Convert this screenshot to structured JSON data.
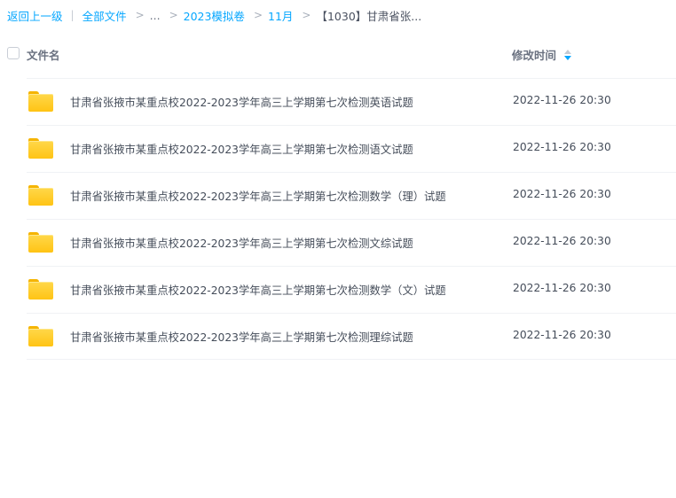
{
  "breadcrumb": {
    "back_label": "返回上一级",
    "divider": "|",
    "items": [
      {
        "label": "全部文件"
      },
      {
        "label": "..."
      },
      {
        "label": "2023模拟卷"
      },
      {
        "label": "11月"
      },
      {
        "label": "【1030】甘肃省张..."
      }
    ]
  },
  "table": {
    "columns": {
      "name": "文件名",
      "modified": "修改时间"
    },
    "rows": [
      {
        "name": "甘肃省张掖市某重点校2022-2023学年高三上学期第七次检测英语试题",
        "time": "2022-11-26 20:30"
      },
      {
        "name": "甘肃省张掖市某重点校2022-2023学年高三上学期第七次检测语文试题",
        "time": "2022-11-26 20:30"
      },
      {
        "name": "甘肃省张掖市某重点校2022-2023学年高三上学期第七次检测数学（理）试题",
        "time": "2022-11-26 20:30"
      },
      {
        "name": "甘肃省张掖市某重点校2022-2023学年高三上学期第七次检测文综试题",
        "time": "2022-11-26 20:30"
      },
      {
        "name": "甘肃省张掖市某重点校2022-2023学年高三上学期第七次检测数学（文）试题",
        "time": "2022-11-26 20:30"
      },
      {
        "name": "甘肃省张掖市某重点校2022-2023学年高三上学期第七次检测理综试题",
        "time": "2022-11-26 20:30"
      }
    ]
  },
  "icons": {
    "folder": "folder-icon",
    "sort": "sort-icon",
    "breadcrumb_separator": "chevron-right-icon"
  },
  "colors": {
    "link": "#06a7ff",
    "folder": "#ffc414",
    "text": "#454d5a"
  }
}
